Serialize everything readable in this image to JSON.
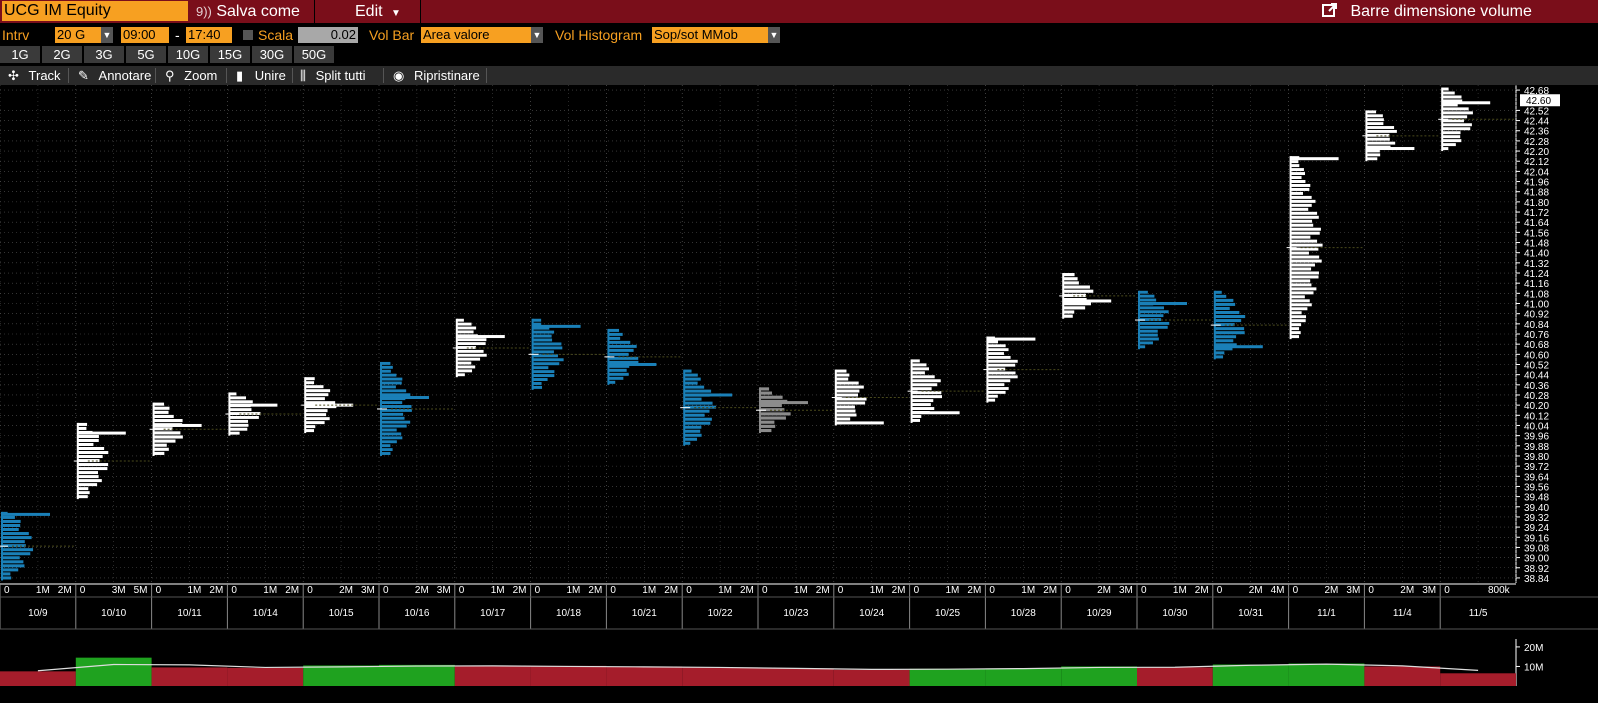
{
  "topbar": {
    "ticker": "UCG IM Equity",
    "save_icon": "save-icon",
    "save_label": "Salva come",
    "edit_label": "Edit",
    "right_label": "Barre dimensione volume",
    "popout_icon": "popout-icon"
  },
  "settings": {
    "intrv_label": "Intrv",
    "intrv_value": "20 G",
    "time_from": "09:00",
    "time_sep": "-",
    "time_to": "17:40",
    "scala_label": "Scala",
    "scala_value": "0.02",
    "volbar_label": "Vol Bar",
    "volbar_value": "Area valore",
    "volhist_label": "Vol Histogram",
    "volhist_value": "Sop/sot MMob"
  },
  "periods": [
    "1G",
    "2G",
    "3G",
    "5G",
    "10G",
    "15G",
    "30G",
    "50G"
  ],
  "tools": [
    {
      "label": "Track",
      "icon": "crosshair-icon"
    },
    {
      "label": "Annotare",
      "icon": "pencil-icon"
    },
    {
      "label": "Zoom",
      "icon": "zoom-icon"
    },
    {
      "label": "Unire",
      "icon": "merge-icon"
    },
    {
      "label": "Split tutti",
      "icon": "split-icon"
    },
    {
      "label": "Ripristinare",
      "icon": "reset-icon"
    }
  ],
  "chart_data": {
    "type": "volume-profile",
    "last_price": "42.60",
    "price_range": [
      38.8,
      42.72
    ],
    "y_ticks": [
      "42.68",
      "42.52",
      "42.44",
      "42.36",
      "42.28",
      "42.20",
      "42.12",
      "42.04",
      "41.96",
      "41.88",
      "41.80",
      "41.72",
      "41.64",
      "41.56",
      "41.48",
      "41.40",
      "41.32",
      "41.24",
      "41.16",
      "41.08",
      "41.00",
      "40.92",
      "40.84",
      "40.76",
      "40.68",
      "40.60",
      "40.52",
      "40.44",
      "40.36",
      "40.28",
      "40.20",
      "40.12",
      "40.04",
      "39.96",
      "39.88",
      "39.80",
      "39.72",
      "39.64",
      "39.56",
      "39.48",
      "39.40",
      "39.32",
      "39.24",
      "39.16",
      "39.08",
      "39.00",
      "38.92",
      "38.84"
    ],
    "days": [
      {
        "date": "10/9",
        "low": 38.82,
        "high": 39.36,
        "poc": 39.34,
        "color": "#1a80b8",
        "scale": [
          "0",
          "1M",
          "2M"
        ],
        "volume": 7.5,
        "trend": "down"
      },
      {
        "date": "10/10",
        "low": 39.46,
        "high": 40.06,
        "poc": 39.98,
        "color": "#ffffff",
        "scale": [
          "0",
          "3M",
          "5M"
        ],
        "volume": 14.5,
        "trend": "up"
      },
      {
        "date": "10/11",
        "low": 39.8,
        "high": 40.22,
        "poc": 40.04,
        "color": "#ffffff",
        "scale": [
          "0",
          "1M",
          "2M"
        ],
        "volume": 9.5,
        "trend": "down"
      },
      {
        "date": "10/14",
        "low": 39.96,
        "high": 40.3,
        "poc": 40.2,
        "color": "#ffffff",
        "scale": [
          "0",
          "1M",
          "2M"
        ],
        "volume": 9.3,
        "trend": "down"
      },
      {
        "date": "10/15",
        "low": 39.98,
        "high": 40.42,
        "poc": 40.2,
        "color": "#ffffff",
        "scale": [
          "0",
          "2M",
          "3M"
        ],
        "volume": 10.5,
        "trend": "up"
      },
      {
        "date": "10/16",
        "low": 39.8,
        "high": 40.54,
        "poc": 40.26,
        "color": "#1a80b8",
        "scale": [
          "0",
          "2M",
          "3M"
        ],
        "volume": 10.8,
        "trend": "up"
      },
      {
        "date": "10/17",
        "low": 40.42,
        "high": 40.88,
        "poc": 40.74,
        "color": "#ffffff",
        "scale": [
          "0",
          "1M",
          "2M"
        ],
        "volume": 10.5,
        "trend": "down"
      },
      {
        "date": "10/18",
        "low": 40.32,
        "high": 40.88,
        "poc": 40.82,
        "color": "#1a80b8",
        "scale": [
          "0",
          "1M",
          "2M"
        ],
        "volume": 10.3,
        "trend": "down"
      },
      {
        "date": "10/21",
        "low": 40.36,
        "high": 40.8,
        "poc": 40.52,
        "color": "#1a80b8",
        "scale": [
          "0",
          "1M",
          "2M"
        ],
        "volume": 10.0,
        "trend": "down"
      },
      {
        "date": "10/22",
        "low": 39.88,
        "high": 40.48,
        "poc": 40.28,
        "color": "#1a80b8",
        "scale": [
          "0",
          "1M",
          "2M"
        ],
        "volume": 9.5,
        "trend": "down"
      },
      {
        "date": "10/23",
        "low": 39.98,
        "high": 40.34,
        "poc": 40.22,
        "color": "#8c8c8c",
        "scale": [
          "0",
          "1M",
          "2M"
        ],
        "volume": 9.0,
        "trend": "down"
      },
      {
        "date": "10/24",
        "low": 40.04,
        "high": 40.48,
        "poc": 40.06,
        "color": "#ffffff",
        "scale": [
          "0",
          "1M",
          "2M"
        ],
        "volume": 8.3,
        "trend": "down"
      },
      {
        "date": "10/25",
        "low": 40.06,
        "high": 40.56,
        "poc": 40.14,
        "color": "#ffffff",
        "scale": [
          "0",
          "1M",
          "2M"
        ],
        "volume": 8.8,
        "trend": "up"
      },
      {
        "date": "10/28",
        "low": 40.22,
        "high": 40.74,
        "poc": 40.72,
        "color": "#ffffff",
        "scale": [
          "0",
          "1M",
          "2M"
        ],
        "volume": 9.0,
        "trend": "up"
      },
      {
        "date": "10/29",
        "low": 40.88,
        "high": 41.24,
        "poc": 41.02,
        "color": "#ffffff",
        "scale": [
          "0",
          "2M",
          "3M"
        ],
        "volume": 10.0,
        "trend": "up"
      },
      {
        "date": "10/30",
        "low": 40.64,
        "high": 41.1,
        "poc": 41.0,
        "color": "#1a80b8",
        "scale": [
          "0",
          "1M",
          "2M"
        ],
        "volume": 9.5,
        "trend": "down"
      },
      {
        "date": "10/31",
        "low": 40.56,
        "high": 41.1,
        "poc": 40.66,
        "color": "#1a80b8",
        "scale": [
          "0",
          "2M",
          "4M"
        ],
        "volume": 11.0,
        "trend": "up"
      },
      {
        "date": "11/1",
        "low": 40.72,
        "high": 42.16,
        "poc": 42.14,
        "color": "#ffffff",
        "scale": [
          "0",
          "2M",
          "3M"
        ],
        "volume": 11.5,
        "trend": "up"
      },
      {
        "date": "11/4",
        "low": 42.12,
        "high": 42.52,
        "poc": 42.22,
        "color": "#ffffff",
        "scale": [
          "0",
          "2M",
          "3M"
        ],
        "volume": 10.0,
        "trend": "down"
      },
      {
        "date": "11/5",
        "low": 42.2,
        "high": 42.7,
        "poc": 42.58,
        "color": "#ffffff",
        "scale": [
          "0",
          "800k"
        ],
        "volume": 6.5,
        "trend": "down"
      }
    ],
    "volume_ticks": [
      "20M",
      "10M"
    ],
    "volume_avg": [
      7.8,
      11.0,
      10.8,
      9.5,
      9.8,
      10.2,
      10.3,
      10.0,
      9.8,
      9.5,
      9.0,
      8.5,
      8.6,
      8.9,
      9.5,
      9.6,
      10.6,
      11.2,
      10.3,
      8.0
    ]
  }
}
